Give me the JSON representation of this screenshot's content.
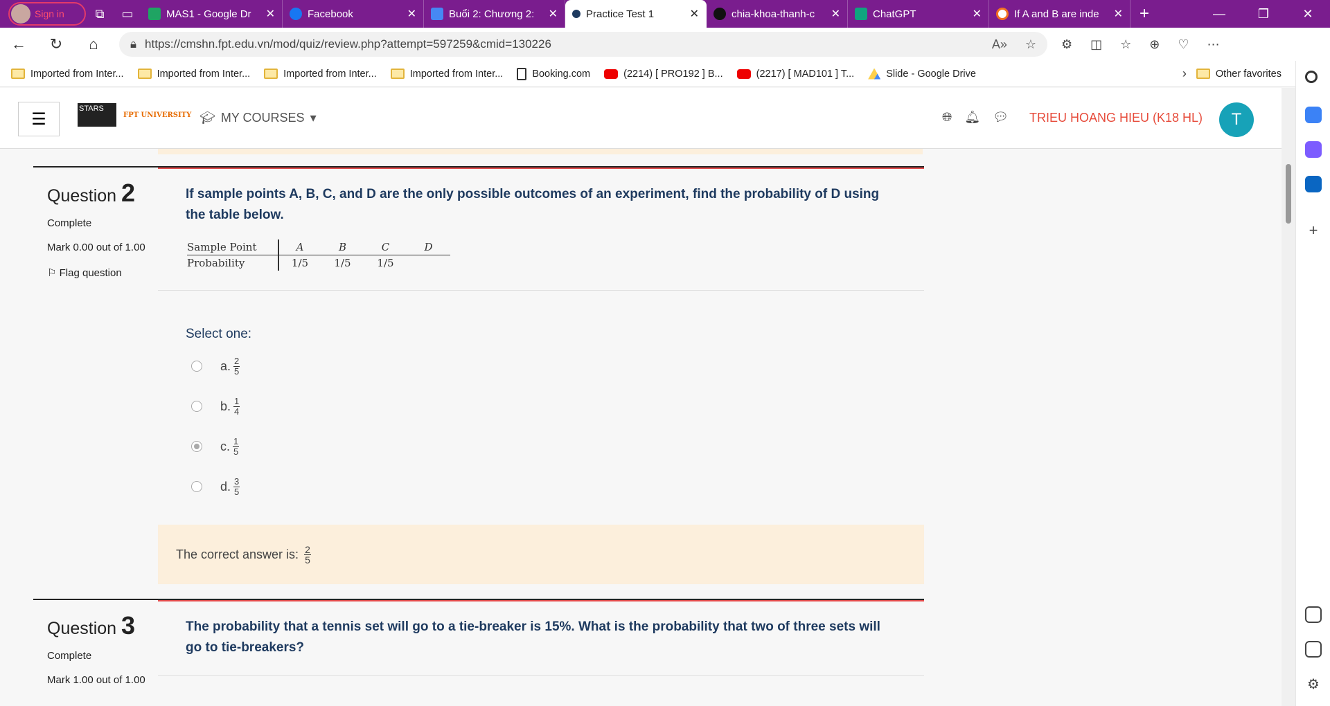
{
  "browser": {
    "profile_label": "Sign in",
    "tabs": [
      {
        "label": "MAS1 - Google Dr",
        "color": "#1fa463"
      },
      {
        "label": "Facebook",
        "color": "#1877f2"
      },
      {
        "label": "Buổi 2: Chương 2:",
        "color": "#4688f4"
      },
      {
        "label": "Practice Test 1",
        "color": "#1e3a5f"
      },
      {
        "label": "chia-khoa-thanh-c",
        "color": "#111111"
      },
      {
        "label": "ChatGPT",
        "color": "#10a37f"
      },
      {
        "label": "If A and B are inde",
        "color": "#f37021"
      }
    ],
    "url": "https://cmshn.fpt.edu.vn/mod/quiz/review.php?attempt=597259&cmid=130226",
    "favorites": [
      {
        "label": "Imported from Inter...",
        "icon": "folder"
      },
      {
        "label": "Imported from Inter...",
        "icon": "folder"
      },
      {
        "label": "Imported from Inter...",
        "icon": "folder"
      },
      {
        "label": "Imported from Inter...",
        "icon": "folder"
      },
      {
        "label": "Booking.com",
        "icon": "doc"
      },
      {
        "label": "(2214) [ PRO192 ] B...",
        "icon": "youtube"
      },
      {
        "label": "(2217) [ MAD101 ] T...",
        "icon": "youtube"
      },
      {
        "label": "Slide - Google Drive",
        "icon": "drive"
      }
    ],
    "other_favorites": "Other favorites"
  },
  "site": {
    "stars_label": "STARS",
    "fpt_label": "FPT UNIVERSITY",
    "my_courses": "MY COURSES",
    "user_name": "TRIEU HOANG HIEU (K18 HL)",
    "user_initial": "T"
  },
  "q2": {
    "title_word": "Question",
    "number": "2",
    "state": "Complete",
    "mark": "Mark 0.00 out of 1.00",
    "flag": "Flag question",
    "text": "If sample points A, B, C, and D are the only possible outcomes of an experiment, find the probability of D using the table below.",
    "table": {
      "row1_label": "Sample Point",
      "row2_label": "Probability",
      "points": [
        "A",
        "B",
        "C",
        "D"
      ],
      "probs": [
        "1/5",
        "1/5",
        "1/5",
        ""
      ]
    },
    "select_one": "Select one:",
    "options": [
      {
        "letter": "a.",
        "num": "2",
        "den": "5",
        "selected": false
      },
      {
        "letter": "b.",
        "num": "1",
        "den": "4",
        "selected": false
      },
      {
        "letter": "c.",
        "num": "1",
        "den": "5",
        "selected": true
      },
      {
        "letter": "d.",
        "num": "3",
        "den": "5",
        "selected": false
      }
    ],
    "feedback_prefix": "The correct answer is:",
    "feedback_num": "2",
    "feedback_den": "5"
  },
  "q3": {
    "title_word": "Question",
    "number": "3",
    "state": "Complete",
    "mark": "Mark 1.00 out of 1.00",
    "text": "The probability that a tennis set will go to a tie-breaker is 15%. What is the probability that two of three sets will go to tie-breakers?"
  }
}
